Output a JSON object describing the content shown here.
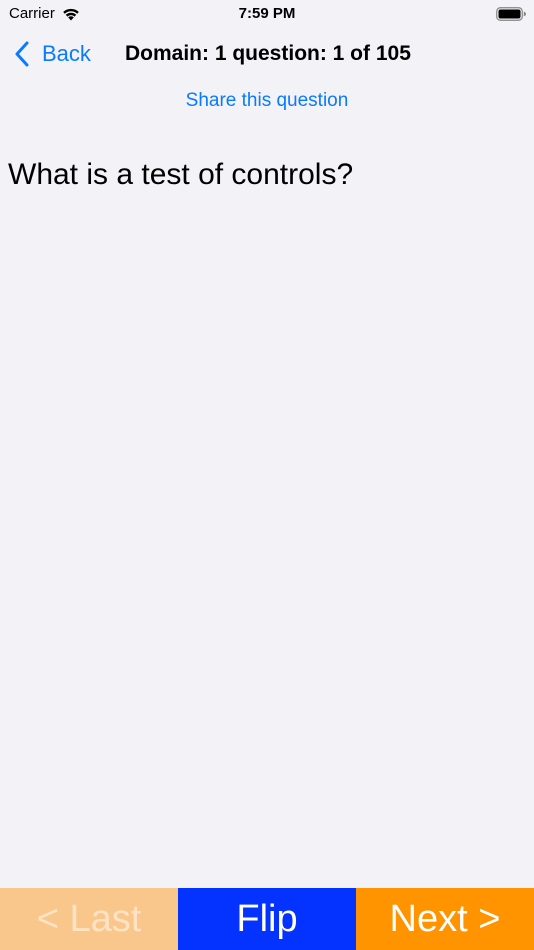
{
  "status_bar": {
    "carrier": "Carrier",
    "time": "7:59 PM",
    "wifi_icon": "wifi-icon",
    "battery_icon": "battery-icon"
  },
  "nav": {
    "back_label": "Back",
    "title": "Domain: 1 question: 1 of 105",
    "back_icon": "chevron-left-icon"
  },
  "share_label": "Share this question",
  "question_text": "What is a test of controls?",
  "buttons": {
    "last_label": "< Last",
    "flip_label": "Flip",
    "next_label": "Next >"
  },
  "colors": {
    "accent": "#0a7aff",
    "background": "#f2f2f7",
    "last_bg": "#f9c78c",
    "flip_bg": "#0433ff",
    "next_bg": "#ff9300"
  }
}
